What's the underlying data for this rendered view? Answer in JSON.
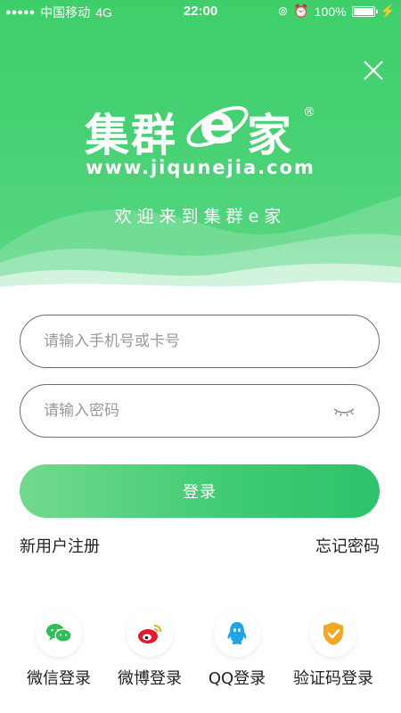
{
  "status_bar": {
    "carrier": "中国移动",
    "network": "4G",
    "time": "22:00",
    "battery_percent": "100%",
    "battery_level": 1.0
  },
  "brand": {
    "name_left": "集群",
    "name_right": "家",
    "letter": "e",
    "registered": "®",
    "url": "www.jiqunejia.com",
    "welcome": "欢迎来到集群e家"
  },
  "form": {
    "phone_placeholder": "请输入手机号或卡号",
    "phone_value": "",
    "password_placeholder": "请输入密码",
    "password_value": "",
    "login_label": "登录"
  },
  "links": {
    "register": "新用户注册",
    "forgot": "忘记密码"
  },
  "social": [
    {
      "label": "微信登录",
      "icon": "wechat-icon",
      "color": "#2fbf55"
    },
    {
      "label": "微博登录",
      "icon": "weibo-icon",
      "color": "#e6162d"
    },
    {
      "label": "QQ登录",
      "icon": "qq-icon",
      "color": "#1fa4e8"
    },
    {
      "label": "验证码登录",
      "icon": "shield-check-icon",
      "color": "#f5a623"
    }
  ],
  "colors": {
    "primary_green": "#3ecb73",
    "hero_green": "#46d173"
  }
}
